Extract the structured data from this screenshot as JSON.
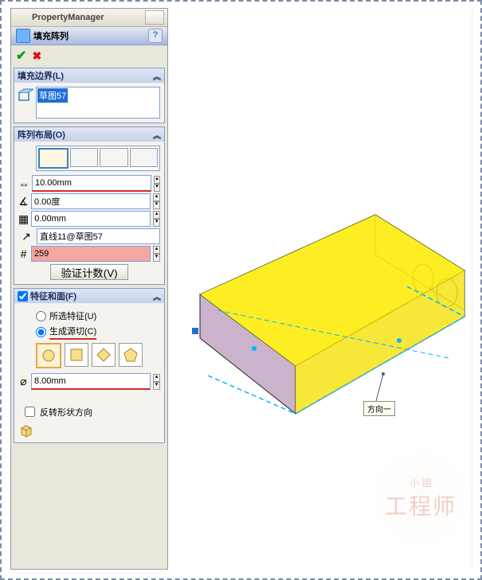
{
  "header": {
    "title": "PropertyManager"
  },
  "command": {
    "icon": "fill-pattern-icon",
    "label": "填充阵列"
  },
  "sections": {
    "fill_boundary": {
      "title": "填充边界(L)",
      "selection": "草图57"
    },
    "layout": {
      "title": "阵列布局(O)",
      "spacing": "10.00mm",
      "angle": "0.00度",
      "margin": "0.00mm",
      "direction": "直线11@草图57",
      "count": "259",
      "validate_btn": "验证计数(V)"
    },
    "features": {
      "title": "特征和面(F)",
      "opt_selected": "所选特征(U)",
      "opt_seed": "生成源切(C)",
      "dim": "8.00mm",
      "flip": "反转形状方向"
    }
  },
  "viewport": {
    "direction_label": "方向一"
  },
  "watermark": {
    "small": "小 國",
    "big": "工程师"
  }
}
